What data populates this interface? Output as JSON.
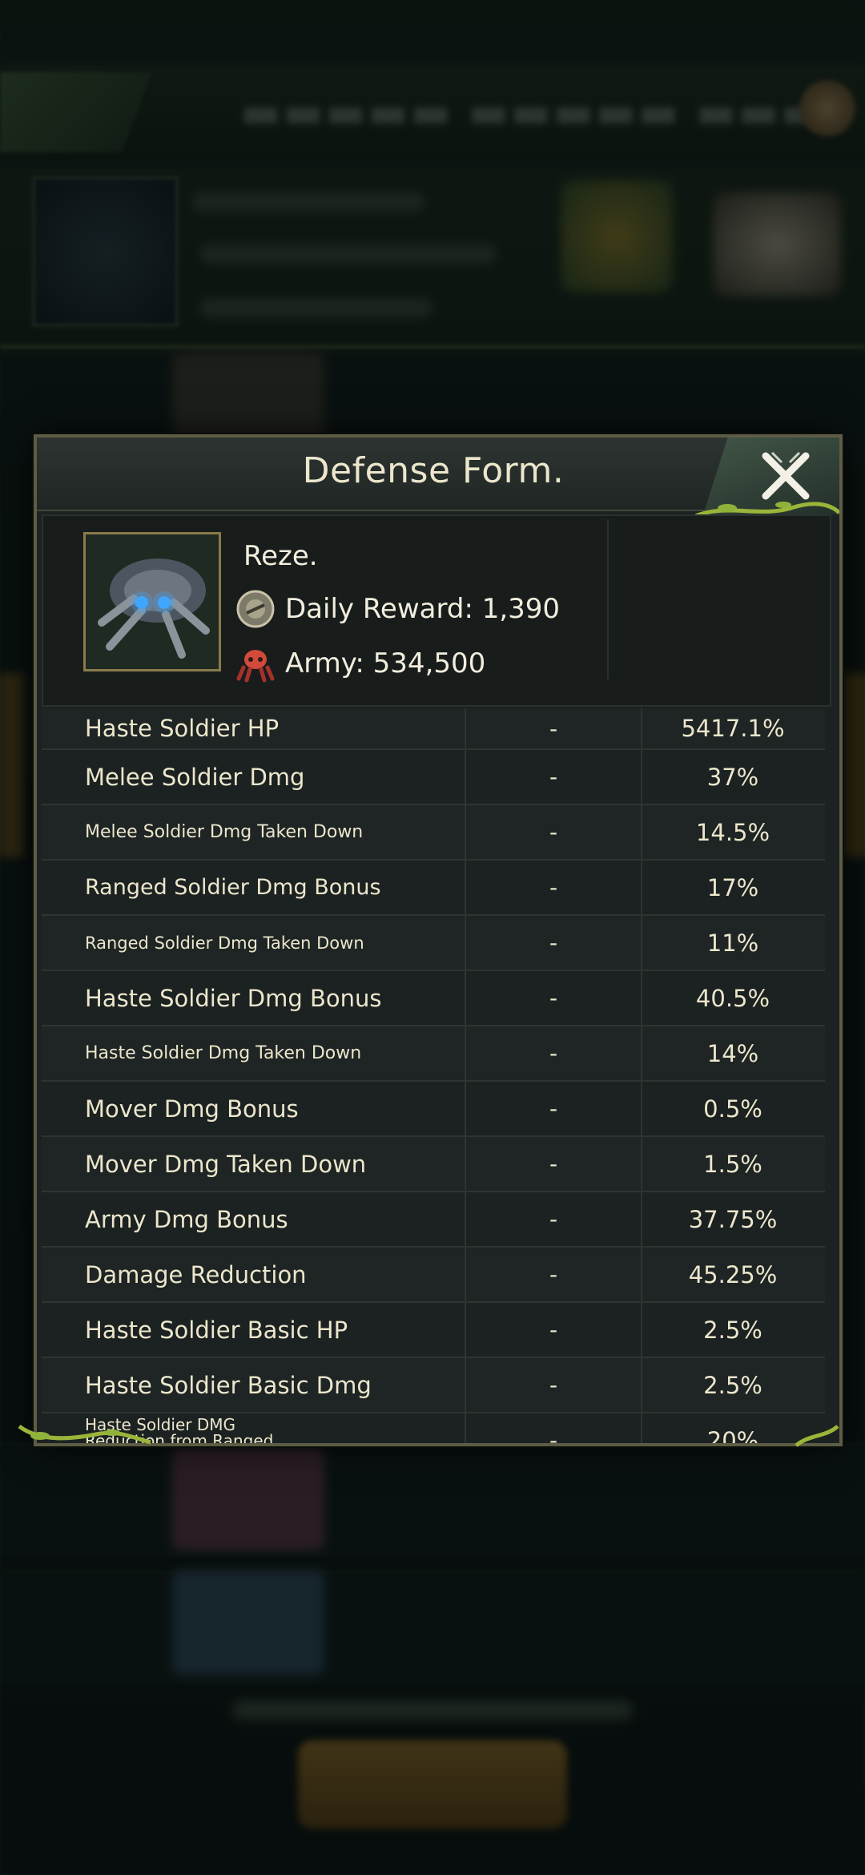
{
  "modal": {
    "title": "Defense Form.",
    "close_icon": "close-x-icon"
  },
  "hero": {
    "name": "Reze.",
    "daily_reward": "Daily Reward: 1,390",
    "army": "Army: 534,500",
    "reward_icon": "reward-coin-icon",
    "army_icon": "army-soldier-icon"
  },
  "stats": [
    {
      "label": "Haste Soldier HP",
      "mid": "-",
      "value": "5417.1%"
    },
    {
      "label": "Melee Soldier Dmg",
      "mid": "-",
      "value": "37%"
    },
    {
      "label": "Melee Soldier Dmg Taken Down",
      "mid": "-",
      "value": "14.5%"
    },
    {
      "label": "Ranged Soldier Dmg Bonus",
      "mid": "-",
      "value": "17%"
    },
    {
      "label": "Ranged Soldier Dmg Taken Down",
      "mid": "-",
      "value": "11%"
    },
    {
      "label": "Haste Soldier Dmg Bonus",
      "mid": "-",
      "value": "40.5%"
    },
    {
      "label": "Haste Soldier Dmg Taken Down",
      "mid": "-",
      "value": "14%"
    },
    {
      "label": "Mover Dmg Bonus",
      "mid": "-",
      "value": "0.5%"
    },
    {
      "label": "Mover Dmg Taken Down",
      "mid": "-",
      "value": "1.5%"
    },
    {
      "label": "Army Dmg Bonus",
      "mid": "-",
      "value": "37.75%"
    },
    {
      "label": "Damage Reduction",
      "mid": "-",
      "value": "45.25%"
    },
    {
      "label": "Haste Soldier Basic HP",
      "mid": "-",
      "value": "2.5%"
    },
    {
      "label": "Haste Soldier Basic Dmg",
      "mid": "-",
      "value": "2.5%"
    },
    {
      "label": "Haste Soldier DMG Reduction from Ranged Soldiers",
      "mid": "-",
      "value": "20%"
    }
  ]
}
